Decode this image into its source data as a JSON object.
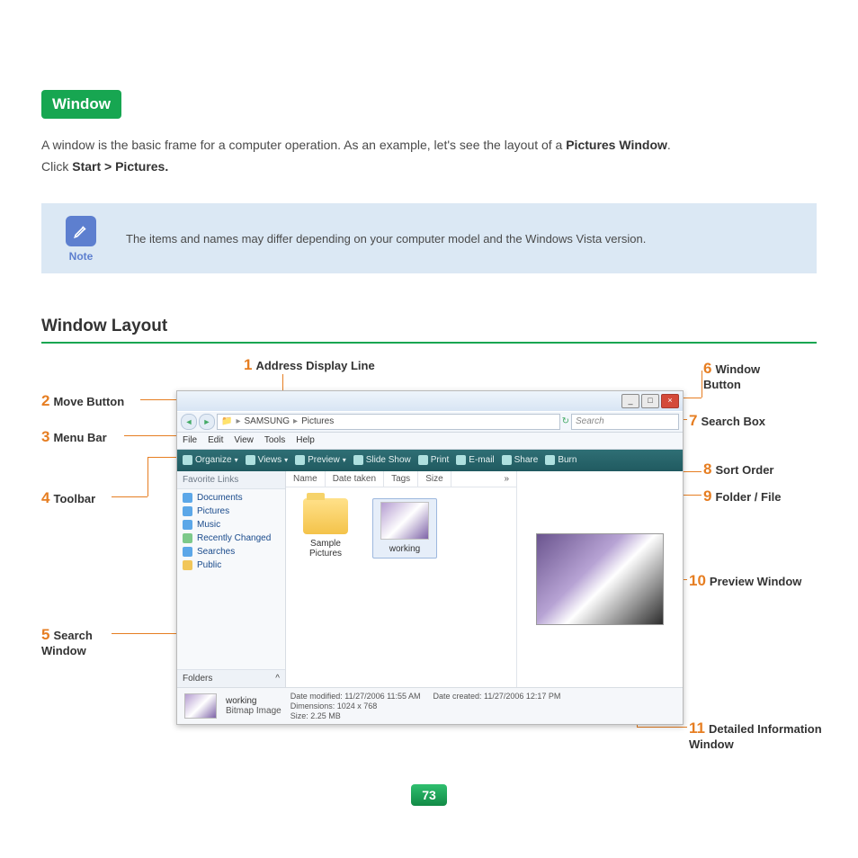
{
  "section_title": "Window",
  "intro_line1_a": "A window is the basic frame for a computer operation. As an example, let's see the layout of a ",
  "intro_line1_b": "Pictures Window",
  "intro_line1_c": ".",
  "intro_line2_a": "Click ",
  "intro_line2_b": "Start > Pictures.",
  "note": {
    "label": "Note",
    "text": "The items and names may differ depending on your computer model and the Windows Vista version."
  },
  "layout_heading": "Window Layout",
  "callouts": {
    "c1": {
      "num": "1",
      "label": "Address Display Line"
    },
    "c2": {
      "num": "2",
      "label": "Move Button"
    },
    "c3": {
      "num": "3",
      "label": "Menu Bar"
    },
    "c4": {
      "num": "4",
      "label": "Toolbar"
    },
    "c5": {
      "num": "5",
      "label": "Search Window"
    },
    "c6": {
      "num": "6",
      "label": "Window Button"
    },
    "c7": {
      "num": "7",
      "label": "Search Box"
    },
    "c8": {
      "num": "8",
      "label": "Sort Order"
    },
    "c9": {
      "num": "9",
      "label": "Folder / File"
    },
    "c10": {
      "num": "10",
      "label": "Preview Window"
    },
    "c11": {
      "num": "11",
      "label": "Detailed Information Window"
    }
  },
  "explorer": {
    "wb_min": "_",
    "wb_max": "□",
    "wb_close": "×",
    "breadcrumb": {
      "root": "SAMSUNG",
      "sep": "▸",
      "cur": "Pictures"
    },
    "search_placeholder": "Search",
    "menubar": [
      "File",
      "Edit",
      "View",
      "Tools",
      "Help"
    ],
    "toolbar": [
      "Organize",
      "Views",
      "Preview",
      "Slide Show",
      "Print",
      "E-mail",
      "Share",
      "Burn"
    ],
    "sidebar_title": "Favorite Links",
    "sidebar_items": [
      "Documents",
      "Pictures",
      "Music",
      "Recently Changed",
      "Searches",
      "Public"
    ],
    "folders_label": "Folders",
    "columns": [
      "Name",
      "Date taken",
      "Tags",
      "Size",
      "»"
    ],
    "thumbs": [
      {
        "name": "Sample Pictures",
        "type": "folder"
      },
      {
        "name": "working",
        "type": "image"
      }
    ],
    "details": {
      "name": "working",
      "type": "Bitmap Image",
      "mod_label": "Date modified:",
      "mod": "11/27/2006 11:55 AM",
      "dim_label": "Dimensions:",
      "dim": "1024 x 768",
      "size_label": "Size:",
      "size": "2.25 MB",
      "created_label": "Date created:",
      "created": "11/27/2006 12:17 PM"
    }
  },
  "page_number": "73"
}
